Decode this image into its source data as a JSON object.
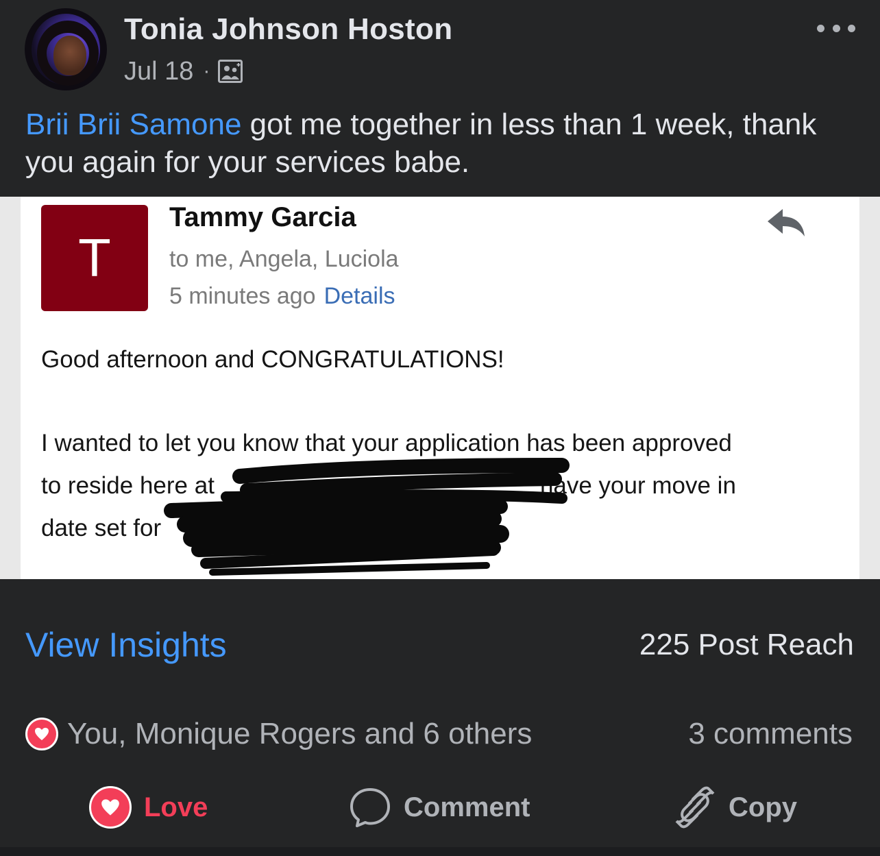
{
  "post": {
    "author": "Tonia Johnson Hoston",
    "date": "Jul 18",
    "separator": "·",
    "audience_icon": "custom-audience-icon",
    "caption": {
      "mention": "Brii Brii Samone",
      "text": " got me together in less than 1 week, thank you again for your services babe."
    }
  },
  "email": {
    "sender_initial": "T",
    "sender_name": "Tammy Garcia",
    "recipients": "to me, Angela, Luciola",
    "time": "5 minutes ago",
    "details_link": "Details",
    "greeting": "Good afternoon and CONGRATULATIONS!",
    "line1": "I wanted to let you know that your application has been approved",
    "line2_start": "to reside here at",
    "line2_end": "have your move in",
    "line3_start": "date set for"
  },
  "insights": {
    "link": "View Insights",
    "reach": "225 Post Reach"
  },
  "reactions": {
    "summary": "You, Monique Rogers and 6 others",
    "comments": "3 comments"
  },
  "actions": {
    "love": "Love",
    "comment": "Comment",
    "copy": "Copy"
  },
  "colors": {
    "background": "#242526",
    "link_blue": "#4599ff",
    "love_red": "#f33e58",
    "email_tile": "#820013"
  }
}
